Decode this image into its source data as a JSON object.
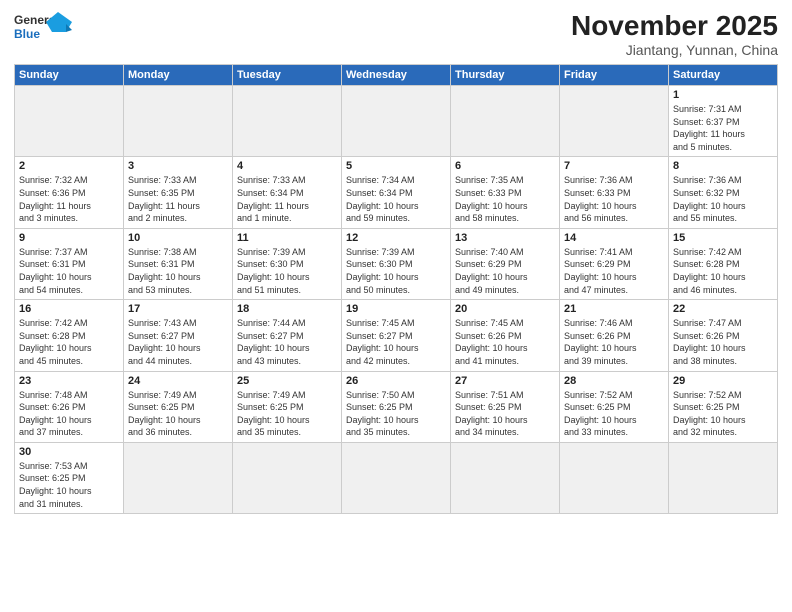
{
  "logo": {
    "line1": "General",
    "line2": "Blue"
  },
  "title": "November 2025",
  "subtitle": "Jiantang, Yunnan, China",
  "weekdays": [
    "Sunday",
    "Monday",
    "Tuesday",
    "Wednesday",
    "Thursday",
    "Friday",
    "Saturday"
  ],
  "weeks": [
    [
      {
        "day": "",
        "info": ""
      },
      {
        "day": "",
        "info": ""
      },
      {
        "day": "",
        "info": ""
      },
      {
        "day": "",
        "info": ""
      },
      {
        "day": "",
        "info": ""
      },
      {
        "day": "",
        "info": ""
      },
      {
        "day": "1",
        "info": "Sunrise: 7:31 AM\nSunset: 6:37 PM\nDaylight: 11 hours\nand 5 minutes."
      }
    ],
    [
      {
        "day": "2",
        "info": "Sunrise: 7:32 AM\nSunset: 6:36 PM\nDaylight: 11 hours\nand 3 minutes."
      },
      {
        "day": "3",
        "info": "Sunrise: 7:33 AM\nSunset: 6:35 PM\nDaylight: 11 hours\nand 2 minutes."
      },
      {
        "day": "4",
        "info": "Sunrise: 7:33 AM\nSunset: 6:34 PM\nDaylight: 11 hours\nand 1 minute."
      },
      {
        "day": "5",
        "info": "Sunrise: 7:34 AM\nSunset: 6:34 PM\nDaylight: 10 hours\nand 59 minutes."
      },
      {
        "day": "6",
        "info": "Sunrise: 7:35 AM\nSunset: 6:33 PM\nDaylight: 10 hours\nand 58 minutes."
      },
      {
        "day": "7",
        "info": "Sunrise: 7:36 AM\nSunset: 6:33 PM\nDaylight: 10 hours\nand 56 minutes."
      },
      {
        "day": "8",
        "info": "Sunrise: 7:36 AM\nSunset: 6:32 PM\nDaylight: 10 hours\nand 55 minutes."
      }
    ],
    [
      {
        "day": "9",
        "info": "Sunrise: 7:37 AM\nSunset: 6:31 PM\nDaylight: 10 hours\nand 54 minutes."
      },
      {
        "day": "10",
        "info": "Sunrise: 7:38 AM\nSunset: 6:31 PM\nDaylight: 10 hours\nand 53 minutes."
      },
      {
        "day": "11",
        "info": "Sunrise: 7:39 AM\nSunset: 6:30 PM\nDaylight: 10 hours\nand 51 minutes."
      },
      {
        "day": "12",
        "info": "Sunrise: 7:39 AM\nSunset: 6:30 PM\nDaylight: 10 hours\nand 50 minutes."
      },
      {
        "day": "13",
        "info": "Sunrise: 7:40 AM\nSunset: 6:29 PM\nDaylight: 10 hours\nand 49 minutes."
      },
      {
        "day": "14",
        "info": "Sunrise: 7:41 AM\nSunset: 6:29 PM\nDaylight: 10 hours\nand 47 minutes."
      },
      {
        "day": "15",
        "info": "Sunrise: 7:42 AM\nSunset: 6:28 PM\nDaylight: 10 hours\nand 46 minutes."
      }
    ],
    [
      {
        "day": "16",
        "info": "Sunrise: 7:42 AM\nSunset: 6:28 PM\nDaylight: 10 hours\nand 45 minutes."
      },
      {
        "day": "17",
        "info": "Sunrise: 7:43 AM\nSunset: 6:27 PM\nDaylight: 10 hours\nand 44 minutes."
      },
      {
        "day": "18",
        "info": "Sunrise: 7:44 AM\nSunset: 6:27 PM\nDaylight: 10 hours\nand 43 minutes."
      },
      {
        "day": "19",
        "info": "Sunrise: 7:45 AM\nSunset: 6:27 PM\nDaylight: 10 hours\nand 42 minutes."
      },
      {
        "day": "20",
        "info": "Sunrise: 7:45 AM\nSunset: 6:26 PM\nDaylight: 10 hours\nand 41 minutes."
      },
      {
        "day": "21",
        "info": "Sunrise: 7:46 AM\nSunset: 6:26 PM\nDaylight: 10 hours\nand 39 minutes."
      },
      {
        "day": "22",
        "info": "Sunrise: 7:47 AM\nSunset: 6:26 PM\nDaylight: 10 hours\nand 38 minutes."
      }
    ],
    [
      {
        "day": "23",
        "info": "Sunrise: 7:48 AM\nSunset: 6:26 PM\nDaylight: 10 hours\nand 37 minutes."
      },
      {
        "day": "24",
        "info": "Sunrise: 7:49 AM\nSunset: 6:25 PM\nDaylight: 10 hours\nand 36 minutes."
      },
      {
        "day": "25",
        "info": "Sunrise: 7:49 AM\nSunset: 6:25 PM\nDaylight: 10 hours\nand 35 minutes."
      },
      {
        "day": "26",
        "info": "Sunrise: 7:50 AM\nSunset: 6:25 PM\nDaylight: 10 hours\nand 35 minutes."
      },
      {
        "day": "27",
        "info": "Sunrise: 7:51 AM\nSunset: 6:25 PM\nDaylight: 10 hours\nand 34 minutes."
      },
      {
        "day": "28",
        "info": "Sunrise: 7:52 AM\nSunset: 6:25 PM\nDaylight: 10 hours\nand 33 minutes."
      },
      {
        "day": "29",
        "info": "Sunrise: 7:52 AM\nSunset: 6:25 PM\nDaylight: 10 hours\nand 32 minutes."
      }
    ],
    [
      {
        "day": "30",
        "info": "Sunrise: 7:53 AM\nSunset: 6:25 PM\nDaylight: 10 hours\nand 31 minutes."
      },
      {
        "day": "",
        "info": ""
      },
      {
        "day": "",
        "info": ""
      },
      {
        "day": "",
        "info": ""
      },
      {
        "day": "",
        "info": ""
      },
      {
        "day": "",
        "info": ""
      },
      {
        "day": "",
        "info": ""
      }
    ]
  ]
}
